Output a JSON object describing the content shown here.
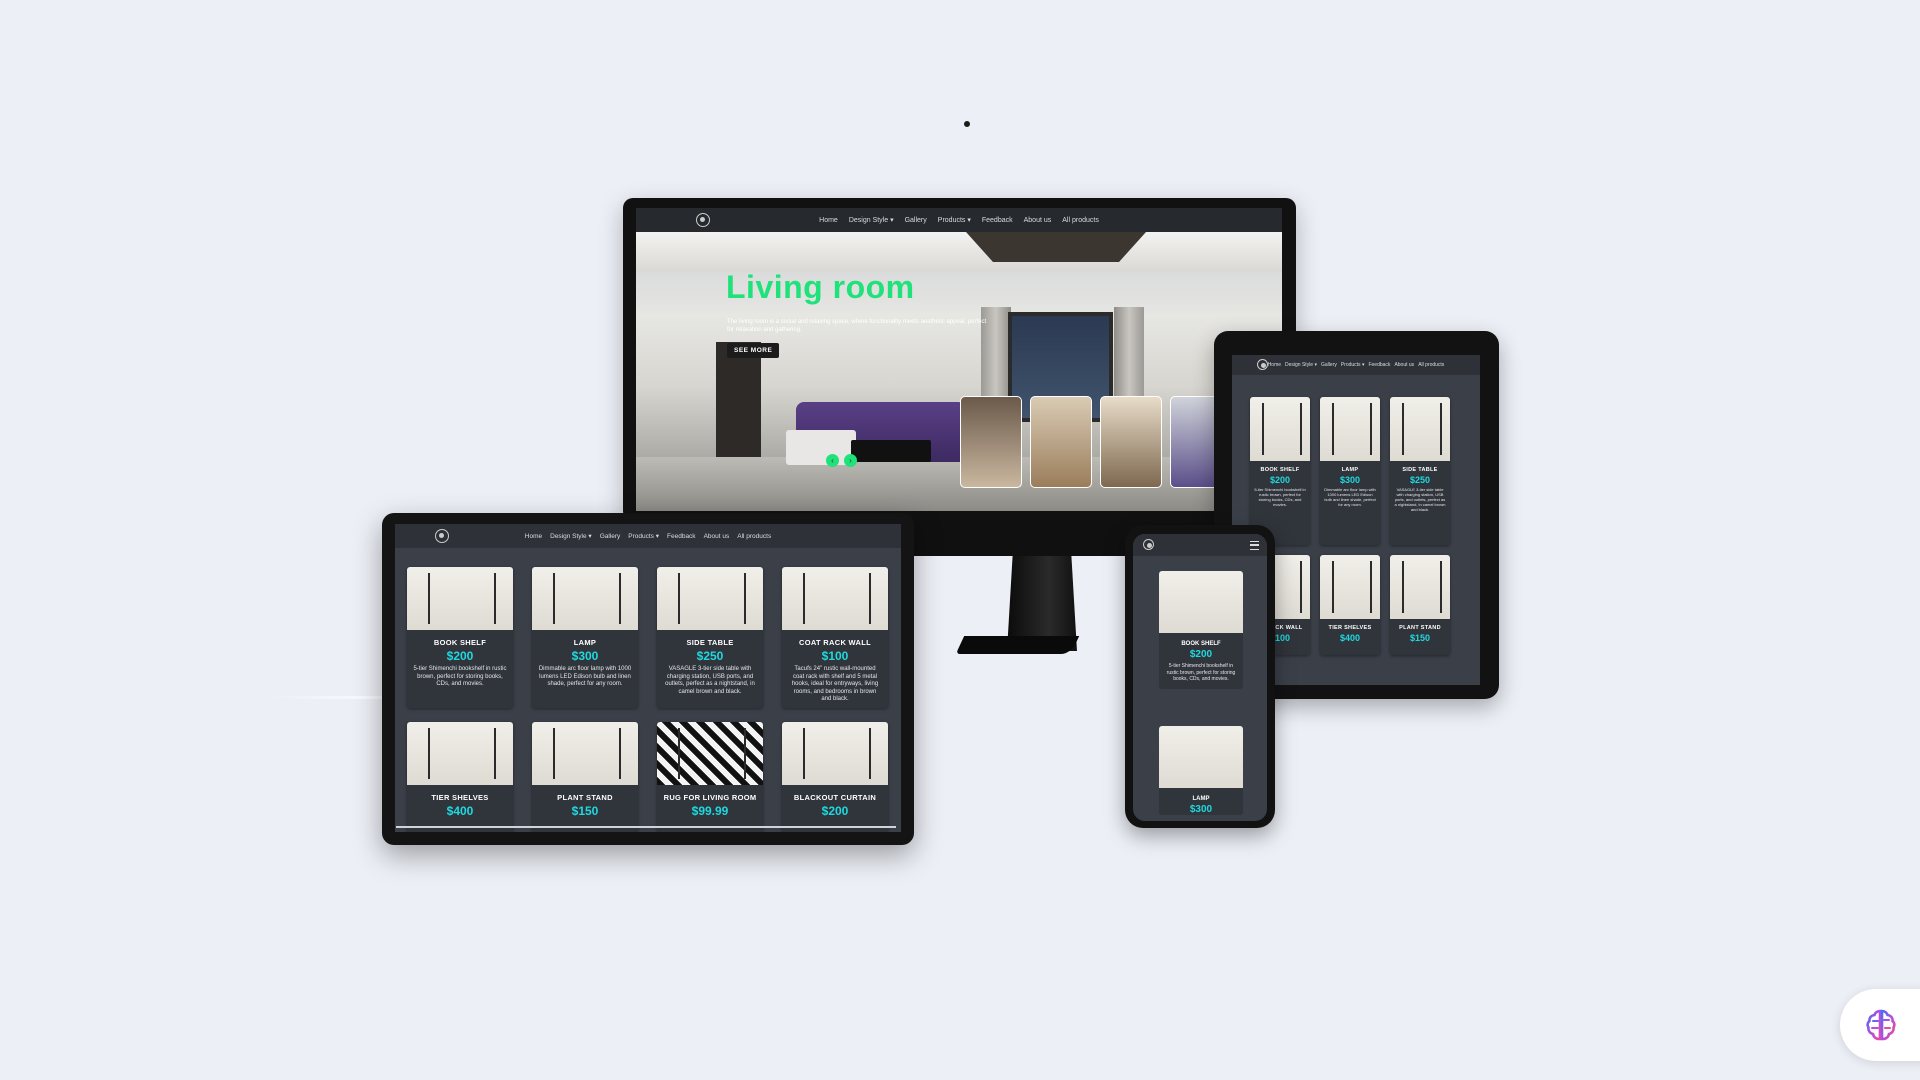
{
  "site_nav": {
    "links": [
      "Home",
      "Design Style ▾",
      "Gallery",
      "Products ▾",
      "Feedback",
      "About us",
      "All products"
    ]
  },
  "hero": {
    "title": "Living room",
    "description": "The living room is a social and relaxing space, where functionality meets aesthetic appeal, perfect for relaxation and gathering.",
    "button": "SEE MORE",
    "prev_arrow": "‹",
    "next_arrow": "›"
  },
  "products": [
    {
      "name": "BOOK SHELF",
      "price": "$200",
      "desc": "5-tier Shimenchi bookshelf in rustic brown, perfect for storing books, CDs, and movies."
    },
    {
      "name": "LAMP",
      "price": "$300",
      "desc": "Dimmable arc floor lamp with 1000 lumens LED Edison bulb and linen shade, perfect for any room."
    },
    {
      "name": "SIDE TABLE",
      "price": "$250",
      "desc": "VASAGLE 3-tier side table with charging station, USB ports, and outlets, perfect as a nightstand, in camel brown and black."
    },
    {
      "name": "COAT RACK WALL",
      "price": "$100",
      "desc": "Tacufs 24\" rustic wall-mounted coat rack with shelf and 5 metal hooks, ideal for entryways, living rooms, and bedrooms in brown and black."
    },
    {
      "name": "TIER SHELVES",
      "price": "$400"
    },
    {
      "name": "PLANT STAND",
      "price": "$150"
    },
    {
      "name": "RUG FOR LIVING ROOM",
      "price": "$99.99"
    },
    {
      "name": "BLACKOUT CURTAIN",
      "price": "$200"
    }
  ],
  "ipad_bottom_names": [
    "AT RACK WALL",
    "TIER SHELVES",
    "PLANT STAND"
  ],
  "colors": {
    "accent_green": "#1fe27a",
    "price_cyan": "#1fd9e0",
    "card_bg": "#30343b",
    "page_bg": "#eceff6"
  },
  "icons": {
    "brain": "brain-icon",
    "menu": "hamburger-menu-icon",
    "chat": "chat-icon"
  }
}
